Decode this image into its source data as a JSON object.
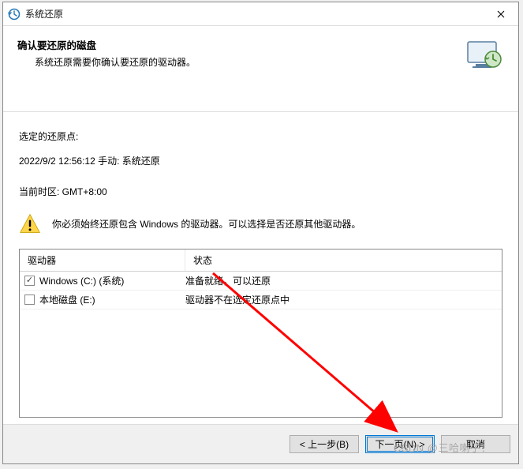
{
  "window": {
    "title": "系统还原"
  },
  "header": {
    "heading": "确认要还原的磁盘",
    "subheading": "系统还原需要你确认要还原的驱动器。"
  },
  "labels": {
    "selected_restore_point": "选定的还原点:",
    "restore_point_value": "2022/9/2 12:56:12 手动: 系统还原",
    "timezone": "当前时区: GMT+8:00",
    "warning": "你必须始终还原包含 Windows 的驱动器。可以选择是否还原其他驱动器。"
  },
  "table": {
    "columns": {
      "drive": "驱动器",
      "status": "状态"
    },
    "rows": [
      {
        "checked": true,
        "drive": "Windows (C:) (系统)",
        "status": "准备就绪，可以还原"
      },
      {
        "checked": false,
        "drive": "本地磁盘 (E:)",
        "status": "驱动器不在选定还原点中"
      }
    ]
  },
  "buttons": {
    "back": "< 上一步(B)",
    "next": "下一页(N) >",
    "cancel": "取消"
  },
  "watermark": "CSDN @三哈喇子！"
}
